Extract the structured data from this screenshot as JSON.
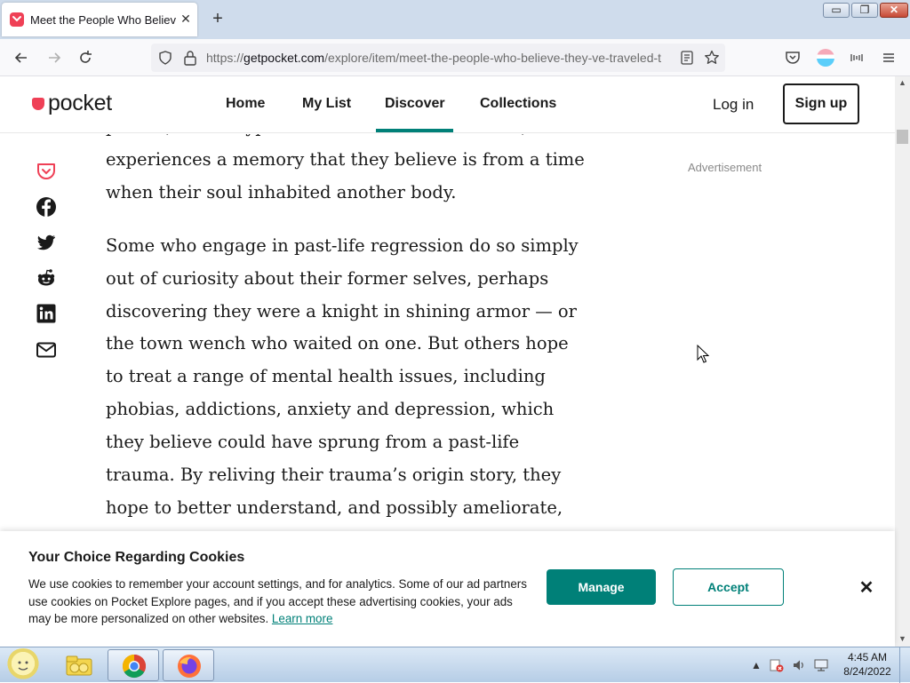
{
  "browser": {
    "tab_title": "Meet the People Who Believe They've Traveled",
    "tab_close": "✕",
    "new_tab": "+",
    "url_prefix": "https://",
    "url_host": "getpocket.com",
    "url_path": "/explore/item/meet-the-people-who-believe-they-ve-traveled-t"
  },
  "window": {
    "minimize": "▭",
    "maximize": "❐",
    "close": "✕"
  },
  "site": {
    "logo_text": "pocket",
    "nav": {
      "home": "Home",
      "my_list": "My List",
      "discover": "Discover",
      "collections": "Collections"
    },
    "log_in": "Log in",
    "sign_up": "Sign up",
    "brand_color": "#ef4056",
    "accent_color": "#008078"
  },
  "article": {
    "paragraphs": [
      "person, under hypnosis or in a meditative state, experiences a memory that they believe is from a time when their soul inhabited another body.",
      "Some who engage in past-life regression do so simply out of curiosity about their former selves, perhaps discovering they were a knight in shining armor — or the town wench who waited on one. But others hope to treat a range of mental health issues, including phobias, addictions, anxiety and depression, which they believe could have sprung from a past-life trauma. By reliving their trauma’s origin story, they hope to better understand, and possibly ameliorate,"
    ],
    "advertisement_label": "Advertisement",
    "share_icons": [
      "pocket-icon",
      "facebook-icon",
      "twitter-icon",
      "reddit-icon",
      "linkedin-icon",
      "email-icon"
    ]
  },
  "cookie_banner": {
    "title": "Your Choice Regarding Cookies",
    "text": "We use cookies to remember your account settings, and for analytics. Some of our ad partners use cookies on Pocket Explore pages, and if you accept these advertising cookies, your ads may be more personalized on other websites.",
    "learn_more": "Learn more",
    "manage": "Manage",
    "accept": "Accept",
    "close": "✕"
  },
  "taskbar": {
    "time": "4:45 AM",
    "date": "8/24/2022",
    "apps": [
      "start-orb",
      "file-explorer-icon",
      "chrome-icon",
      "firefox-icon"
    ]
  },
  "scrollbar": {
    "up": "▲",
    "down": "▼"
  }
}
